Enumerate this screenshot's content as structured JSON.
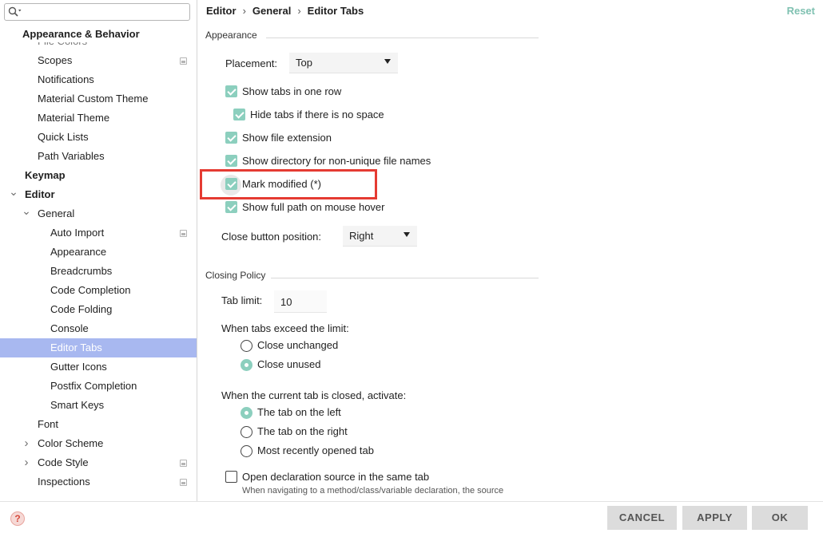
{
  "search": {
    "placeholder": "",
    "icon": "search-icon"
  },
  "sidebar": {
    "section_header": "Appearance & Behavior",
    "clipped_item": "File Colors",
    "items": [
      {
        "label": "Scopes",
        "indent": 2,
        "project": true
      },
      {
        "label": "Notifications",
        "indent": 2
      },
      {
        "label": "Material Custom Theme",
        "indent": 2
      },
      {
        "label": "Material Theme",
        "indent": 2
      },
      {
        "label": "Quick Lists",
        "indent": 2
      },
      {
        "label": "Path Variables",
        "indent": 2
      },
      {
        "label": "Keymap",
        "indent": 1,
        "bold": true
      },
      {
        "label": "Editor",
        "indent": 1,
        "bold": true,
        "arrow": "expanded"
      },
      {
        "label": "General",
        "indent": 2,
        "arrow": "expanded"
      },
      {
        "label": "Auto Import",
        "indent": 3,
        "project": true
      },
      {
        "label": "Appearance",
        "indent": 3
      },
      {
        "label": "Breadcrumbs",
        "indent": 3
      },
      {
        "label": "Code Completion",
        "indent": 3
      },
      {
        "label": "Code Folding",
        "indent": 3
      },
      {
        "label": "Console",
        "indent": 3
      },
      {
        "label": "Editor Tabs",
        "indent": 3,
        "selected": true
      },
      {
        "label": "Gutter Icons",
        "indent": 3
      },
      {
        "label": "Postfix Completion",
        "indent": 3
      },
      {
        "label": "Smart Keys",
        "indent": 3
      },
      {
        "label": "Font",
        "indent": 2
      },
      {
        "label": "Color Scheme",
        "indent": 2,
        "arrow": "collapsed"
      },
      {
        "label": "Code Style",
        "indent": 2,
        "arrow": "collapsed",
        "project": true
      },
      {
        "label": "Inspections",
        "indent": 2,
        "project": true
      }
    ]
  },
  "breadcrumb": {
    "part1": "Editor",
    "part2": "General",
    "part3": "Editor Tabs",
    "sep": "›"
  },
  "reset_label": "Reset",
  "appearance": {
    "title": "Appearance",
    "placement_label": "Placement:",
    "placement_value": "Top",
    "checkboxes": {
      "one_row": {
        "label": "Show tabs in one row",
        "checked": true
      },
      "hide_tabs": {
        "label": "Hide tabs if there is no space",
        "checked": true
      },
      "file_ext": {
        "label": "Show file extension",
        "checked": true
      },
      "directory": {
        "label": "Show directory for non-unique file names",
        "checked": true
      },
      "mark_modified": {
        "label": "Mark modified (*)",
        "checked": true
      },
      "full_path": {
        "label": "Show full path on mouse hover",
        "checked": true
      }
    },
    "close_button_label": "Close button position:",
    "close_button_value": "Right"
  },
  "closing_policy": {
    "title": "Closing Policy",
    "tab_limit_label": "Tab limit:",
    "tab_limit_value": "10",
    "exceed_label": "When tabs exceed the limit:",
    "exceed_options": {
      "unchanged": "Close unchanged",
      "unused": "Close unused",
      "selected": "unused"
    },
    "closed_label": "When the current tab is closed, activate:",
    "activate_options": {
      "left": "The tab on the left",
      "right": "The tab on the right",
      "recent": "Most recently opened tab",
      "selected": "left"
    },
    "open_decl_label": "Open declaration source in the same tab",
    "open_decl_checked": false,
    "open_decl_hint": "When navigating to a method/class/variable declaration, the source"
  },
  "buttons": {
    "cancel": "CANCEL",
    "apply": "APPLY",
    "ok": "OK"
  },
  "help_icon": "?",
  "colors": {
    "accent": "#8ccfbe",
    "selection": "#a8b8f0",
    "highlight_box": "#e53b32",
    "reset": "#7fc1b1"
  }
}
